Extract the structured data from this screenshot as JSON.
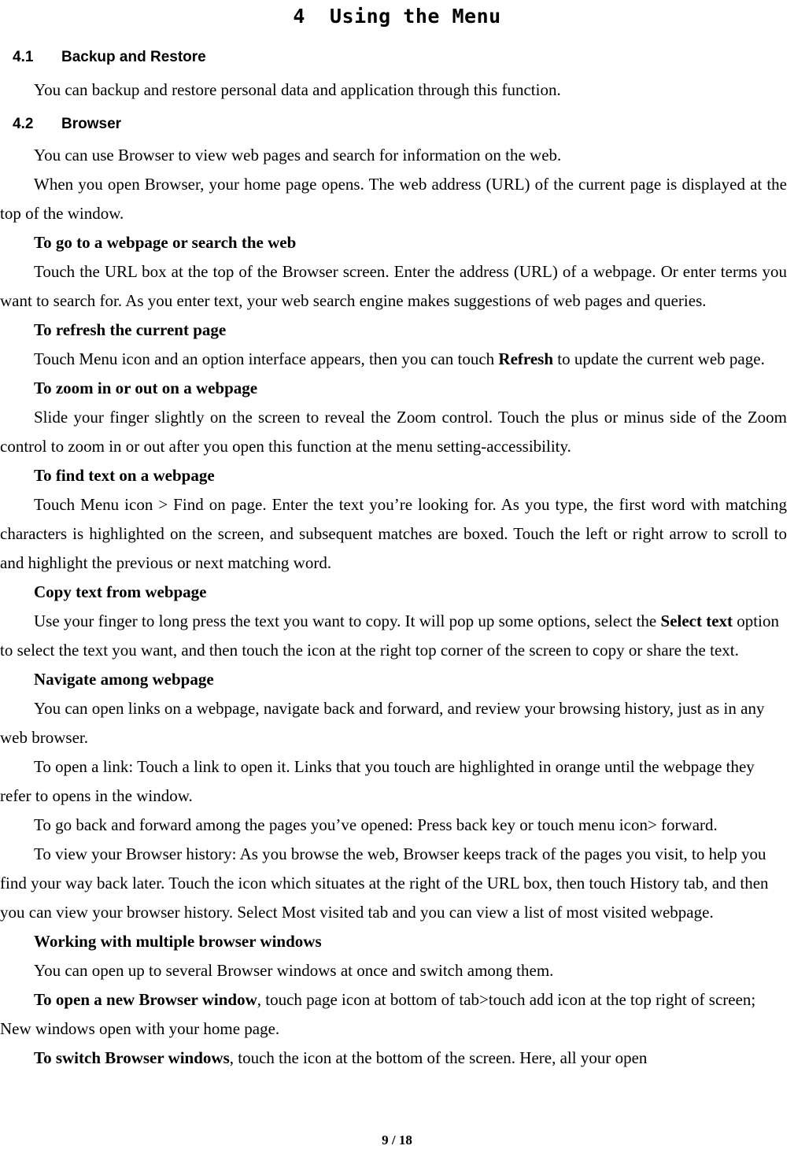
{
  "document": {
    "chapter_title": "4  Using the Menu",
    "footer": "9 / 18"
  },
  "sections": [
    {
      "number": "4.1",
      "title": "Backup and Restore",
      "body": "You can backup and restore personal data and application through this function."
    },
    {
      "number": "4.2",
      "title": "Browser"
    }
  ],
  "browser": {
    "intro_1": "You can use Browser to view web pages and search for information on the web.",
    "intro_2": "When you open Browser, your home page opens. The web address (URL) of the current page is displayed at the top of the window.",
    "topics": [
      {
        "heading": "To go to a webpage or search the web",
        "body": "Touch the URL box at the top of the Browser screen. Enter the address (URL) of a webpage. Or enter terms you want to search for. As you enter text, your web search engine makes suggestions of web pages and queries."
      },
      {
        "heading": "To refresh the current page",
        "body_pre": "Touch Menu icon and an option interface appears, then you can touch ",
        "body_bold": "Refresh",
        "body_post": " to update the current web page."
      },
      {
        "heading": "To zoom in or out on a webpage",
        "body": "Slide your finger slightly on the screen to reveal the Zoom control. Touch the plus or minus side of the Zoom control to zoom in or out after you open this function at the menu setting-accessibility."
      },
      {
        "heading": "To find text on a webpage",
        "body": "Touch Menu icon > Find on page. Enter the text you’re looking for. As you type, the first word with matching characters is highlighted on the screen, and subsequent matches are boxed. Touch the left or right arrow to scroll to and highlight the previous or next matching word."
      },
      {
        "heading": "Copy text from webpage",
        "body_pre": "Use your finger to long press the text you want to copy. It will pop up some options, select the ",
        "body_bold": "Select text",
        "body_post": " option to select the text you want, and then touch the icon at the right top corner of the screen to copy or share the text."
      },
      {
        "heading": "Navigate among webpage",
        "paragraphs": [
          "You can open links on a webpage, navigate back and forward, and review your browsing history, just as in any web browser.",
          "To open a link: Touch a link to open it. Links that you touch are highlighted in orange until the webpage they refer to opens in the window.",
          "To go back and forward among the pages you’ve opened: Press back key or touch menu icon> forward.",
          "To view your Browser history: As you browse the web, Browser keeps track of the pages you visit, to help you find your way back later. Touch the icon which situates at the right of the URL box, then touch History tab, and then you can view your browser history. Select Most visited tab and you can view a list of most visited webpage."
        ]
      },
      {
        "heading": "Working with multiple browser windows",
        "paragraph": "You can open up to several Browser windows at once and switch among them.",
        "items": [
          {
            "bold": "To open a new Browser window",
            "rest": ", touch page icon at bottom of tab>touch add icon at the top right of screen; New windows open with your home page."
          },
          {
            "bold": "To switch Browser windows",
            "rest": ", touch the icon at the bottom of the screen. Here, all your open"
          }
        ]
      }
    ]
  }
}
